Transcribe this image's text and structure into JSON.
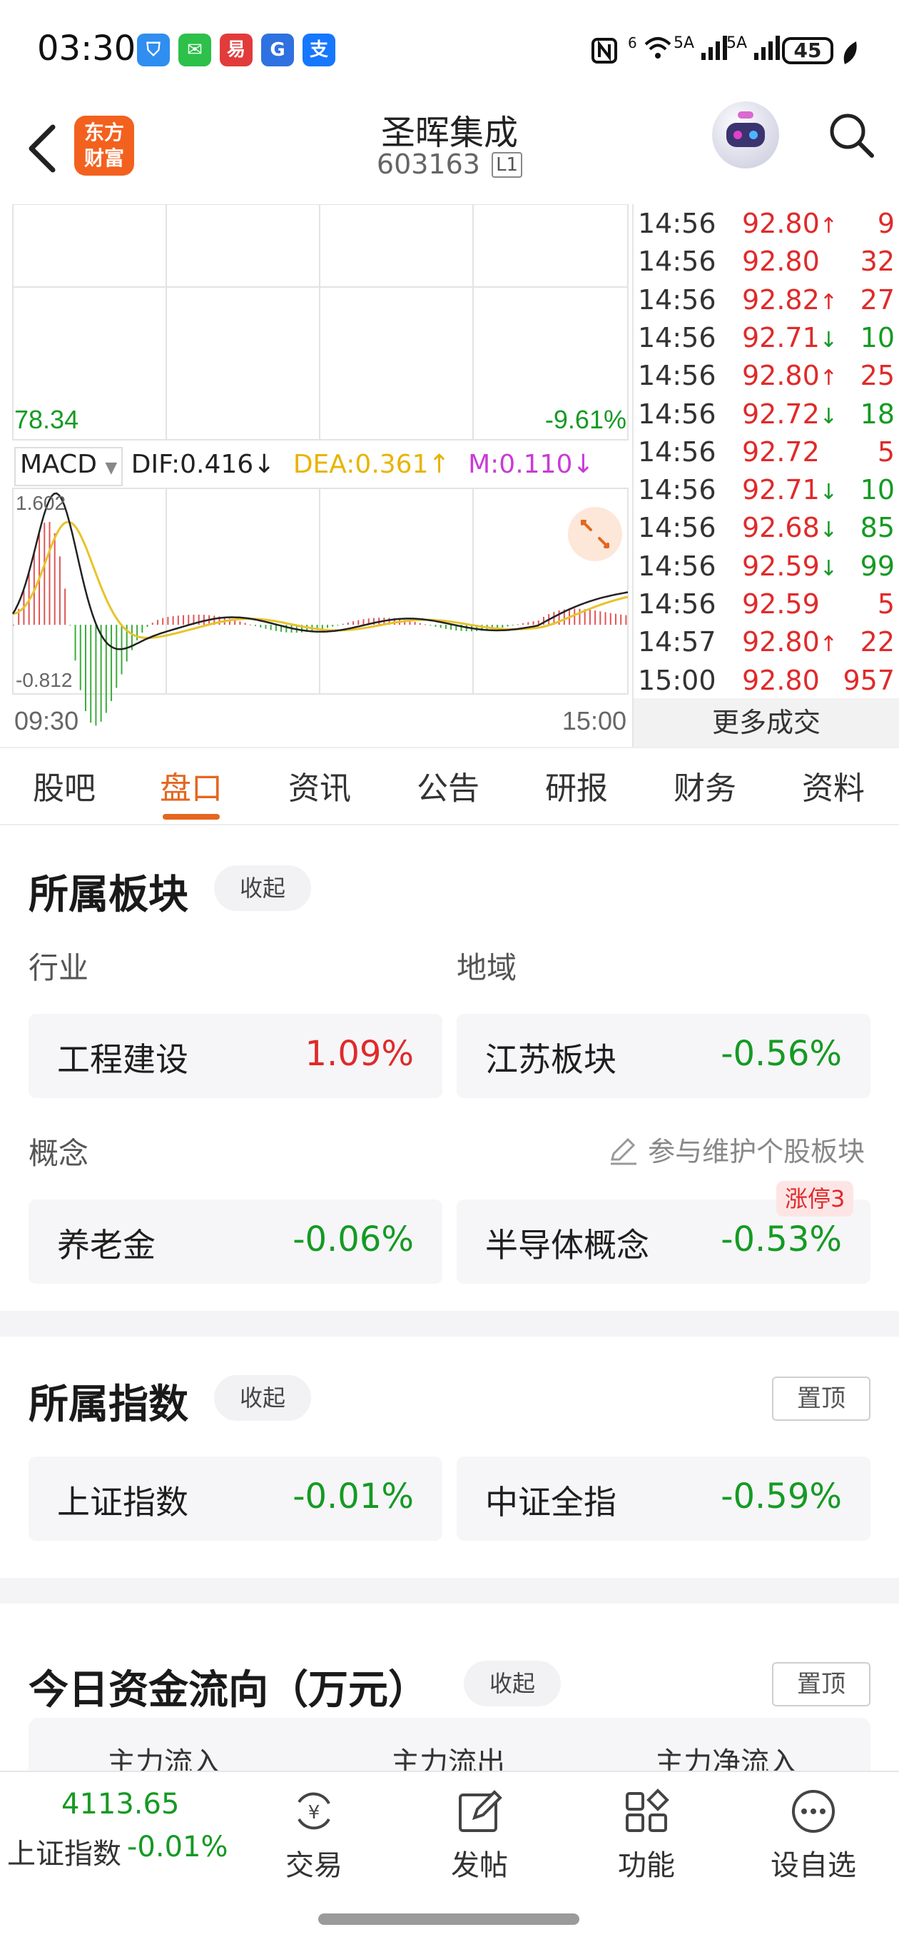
{
  "status_bar": {
    "time": "03:30",
    "signal_1": "5A",
    "signal_2": "5A",
    "wifi_label": "6",
    "battery": "45",
    "app_icons": [
      {
        "name": "shield-icon",
        "color": "#2f8ef0",
        "glyph": "⛉"
      },
      {
        "name": "wechat-icon",
        "color": "#2dc04a",
        "glyph": "✉"
      },
      {
        "name": "netease-icon",
        "color": "#e23b3b",
        "glyph": "易"
      },
      {
        "name": "gf-securities-icon",
        "color": "#2f71e0",
        "glyph": "G"
      },
      {
        "name": "alipay-icon",
        "color": "#1677ff",
        "glyph": "支"
      }
    ]
  },
  "header": {
    "logo_line1": "东方",
    "logo_line2": "财富",
    "stock_name": "圣晖集成",
    "stock_code": "603163",
    "level_badge": "L1"
  },
  "chart": {
    "price_low": "78.34",
    "pct_low": "-9.61%",
    "indicator": "MACD",
    "dif": "DIF:0.416",
    "dea": "DEA:0.361",
    "m": "M:0.110",
    "macd_top": "1.602",
    "macd_bottom": "-0.812",
    "time_start": "09:30",
    "time_end": "15:00",
    "colors": {
      "dif_line": "#222222",
      "dea_line": "#e8c32a",
      "up_bar": "#e05555",
      "down_bar": "#3cab3c"
    }
  },
  "chart_data": {
    "type": "bar",
    "title": "",
    "xlabel": "",
    "ylabel": "",
    "ylim": [
      -0.812,
      1.602
    ],
    "xlim": [
      "09:30",
      "15:00"
    ],
    "grid": true,
    "legend": "top-left",
    "series": [
      {
        "name": "DIF",
        "value": 0.416
      },
      {
        "name": "DEA",
        "value": 0.361
      },
      {
        "name": "M",
        "value": 0.11
      }
    ]
  },
  "trades": {
    "rows": [
      {
        "time": "14:56",
        "price": "92.80",
        "arrow": "↑",
        "vol": "9",
        "dir": "up"
      },
      {
        "time": "14:56",
        "price": "92.80",
        "arrow": "",
        "vol": "32",
        "dir": "up"
      },
      {
        "time": "14:56",
        "price": "92.82",
        "arrow": "↑",
        "vol": "27",
        "dir": "up"
      },
      {
        "time": "14:56",
        "price": "92.71",
        "arrow": "↓",
        "vol": "10",
        "dir": "down"
      },
      {
        "time": "14:56",
        "price": "92.80",
        "arrow": "↑",
        "vol": "25",
        "dir": "up"
      },
      {
        "time": "14:56",
        "price": "92.72",
        "arrow": "↓",
        "vol": "18",
        "dir": "down"
      },
      {
        "time": "14:56",
        "price": "92.72",
        "arrow": "",
        "vol": "5",
        "dir": "up"
      },
      {
        "time": "14:56",
        "price": "92.71",
        "arrow": "↓",
        "vol": "10",
        "dir": "down"
      },
      {
        "time": "14:56",
        "price": "92.68",
        "arrow": "↓",
        "vol": "85",
        "dir": "down"
      },
      {
        "time": "14:56",
        "price": "92.59",
        "arrow": "↓",
        "vol": "99",
        "dir": "down"
      },
      {
        "time": "14:56",
        "price": "92.59",
        "arrow": "",
        "vol": "5",
        "dir": "up"
      },
      {
        "time": "14:57",
        "price": "92.80",
        "arrow": "↑",
        "vol": "22",
        "dir": "up"
      },
      {
        "time": "15:00",
        "price": "92.80",
        "arrow": "",
        "vol": "957",
        "dir": "up"
      }
    ],
    "more_label": "更多成交"
  },
  "tabs": [
    "股吧",
    "盘口",
    "资讯",
    "公告",
    "研报",
    "财务",
    "资料"
  ],
  "sectors": {
    "title": "所属板块",
    "collapse_label": "收起",
    "industry_label": "行业",
    "region_label": "地域",
    "concept_label": "概念",
    "maintain_label": "参与维护个股板块",
    "limit_badge": "涨停3",
    "industry": {
      "name": "工程建设",
      "pct": "1.09%"
    },
    "region": {
      "name": "江苏板块",
      "pct": "-0.56%"
    },
    "concept_1": {
      "name": "养老金",
      "pct": "-0.06%"
    },
    "concept_2": {
      "name": "半导体概念",
      "pct": "-0.53%"
    }
  },
  "indices": {
    "title": "所属指数",
    "collapse_label": "收起",
    "pin_label": "置顶",
    "items": [
      {
        "name": "上证指数",
        "pct": "-0.01%"
      },
      {
        "name": "中证全指",
        "pct": "-0.59%"
      }
    ]
  },
  "fund_flow": {
    "title": "今日资金流向（万元）",
    "collapse_label": "收起",
    "pin_label": "置顶",
    "cols": [
      "主力流入",
      "主力流出",
      "主力净流入"
    ]
  },
  "bottom": {
    "index_value": "4113.65",
    "index_name": "上证指数",
    "index_pct": "-0.01%",
    "nav": [
      "交易",
      "发帖",
      "功能",
      "设自选"
    ]
  }
}
